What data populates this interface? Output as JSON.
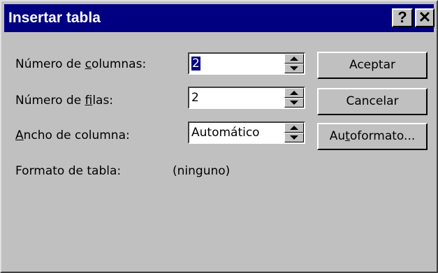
{
  "window": {
    "title": "Insertar tabla",
    "help_label": "?",
    "close_label": "✕"
  },
  "fields": {
    "columns": {
      "label_pre": "Número de ",
      "label_key": "c",
      "label_post": "olumnas:",
      "value": "2"
    },
    "rows": {
      "label_pre": "Número de ",
      "label_key": "f",
      "label_post": "ilas:",
      "value": "2"
    },
    "width": {
      "label_pre": "",
      "label_key": "A",
      "label_post": "ncho de columna:",
      "value": "Automático"
    }
  },
  "format": {
    "label": "Formato de tabla:",
    "value": "(ninguno)"
  },
  "buttons": {
    "ok": "Aceptar",
    "cancel": "Cancelar",
    "autoformat_pre": "Au",
    "autoformat_key": "t",
    "autoformat_post": "oformato..."
  },
  "icons": {
    "spin_up": "arrow-up-icon",
    "spin_down": "arrow-down-icon",
    "help": "question-icon",
    "close": "close-icon"
  },
  "colors": {
    "titlebar": "#000080",
    "face": "#c0c0c0",
    "selection": "#000080"
  }
}
